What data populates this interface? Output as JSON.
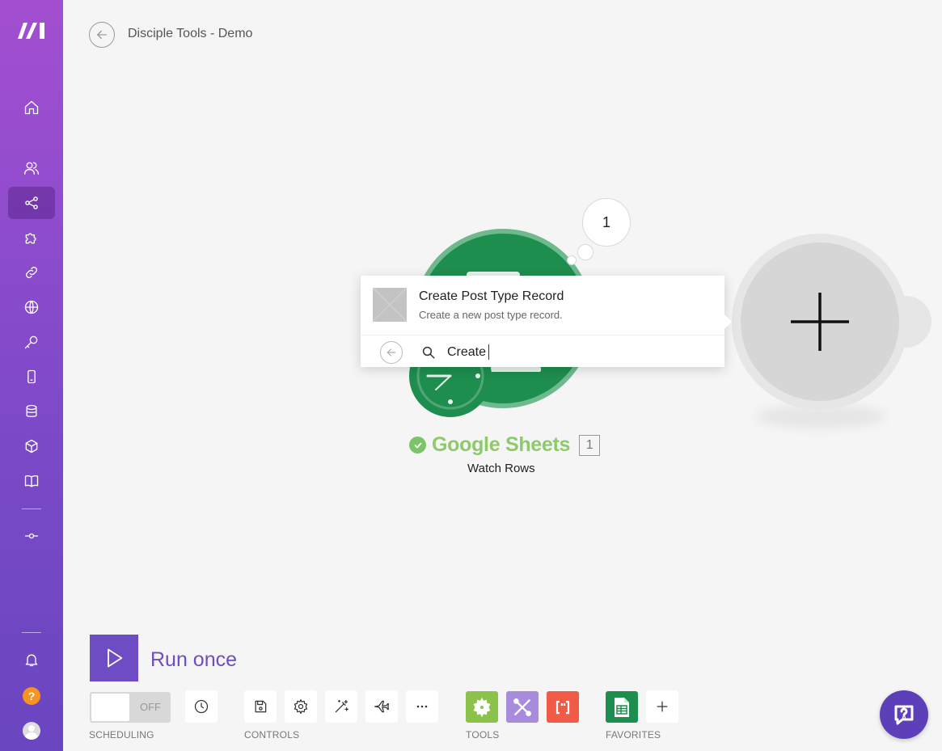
{
  "header": {
    "scenario_title": "Disciple Tools - Demo"
  },
  "sidebar": {
    "items": [
      {
        "name": "home",
        "icon": "home-icon"
      },
      {
        "name": "team",
        "icon": "users-icon"
      },
      {
        "name": "scenarios",
        "icon": "share-icon",
        "active": true
      },
      {
        "name": "templates",
        "icon": "puzzle-icon"
      },
      {
        "name": "connections",
        "icon": "link-icon"
      },
      {
        "name": "webhooks",
        "icon": "globe-icon"
      },
      {
        "name": "keys",
        "icon": "key-icon"
      },
      {
        "name": "devices",
        "icon": "phone-icon"
      },
      {
        "name": "data-stores",
        "icon": "database-icon"
      },
      {
        "name": "data-structures",
        "icon": "cube-icon"
      },
      {
        "name": "docs",
        "icon": "book-icon"
      },
      {
        "name": "flow",
        "icon": "commit-icon"
      }
    ],
    "help_label": "?"
  },
  "canvas": {
    "trigger_module": {
      "app": "Google Sheets",
      "module_id": "1",
      "action": "Watch Rows",
      "bundle_count": "1",
      "brand_color": "#1e8e4e"
    }
  },
  "popup": {
    "result_title": "Create Post Type Record",
    "result_desc": "Create a new post type record.",
    "search_value": "Create"
  },
  "toolbar": {
    "run_label": "Run once",
    "toggle_label": "OFF",
    "sections": {
      "scheduling": "SCHEDULING",
      "controls": "CONTROLS",
      "tools": "TOOLS",
      "favorites": "FAVORITES"
    },
    "tool_colors": {
      "flow_control": "#8bc34a",
      "tools": "#a78bdc",
      "text_parser": "#f15a47",
      "sheets": "#1e8e4e"
    }
  },
  "colors": {
    "accent": "#6d4cc4",
    "sidebar_top": "#a34fd1",
    "sidebar_bottom": "#6a46c0"
  }
}
